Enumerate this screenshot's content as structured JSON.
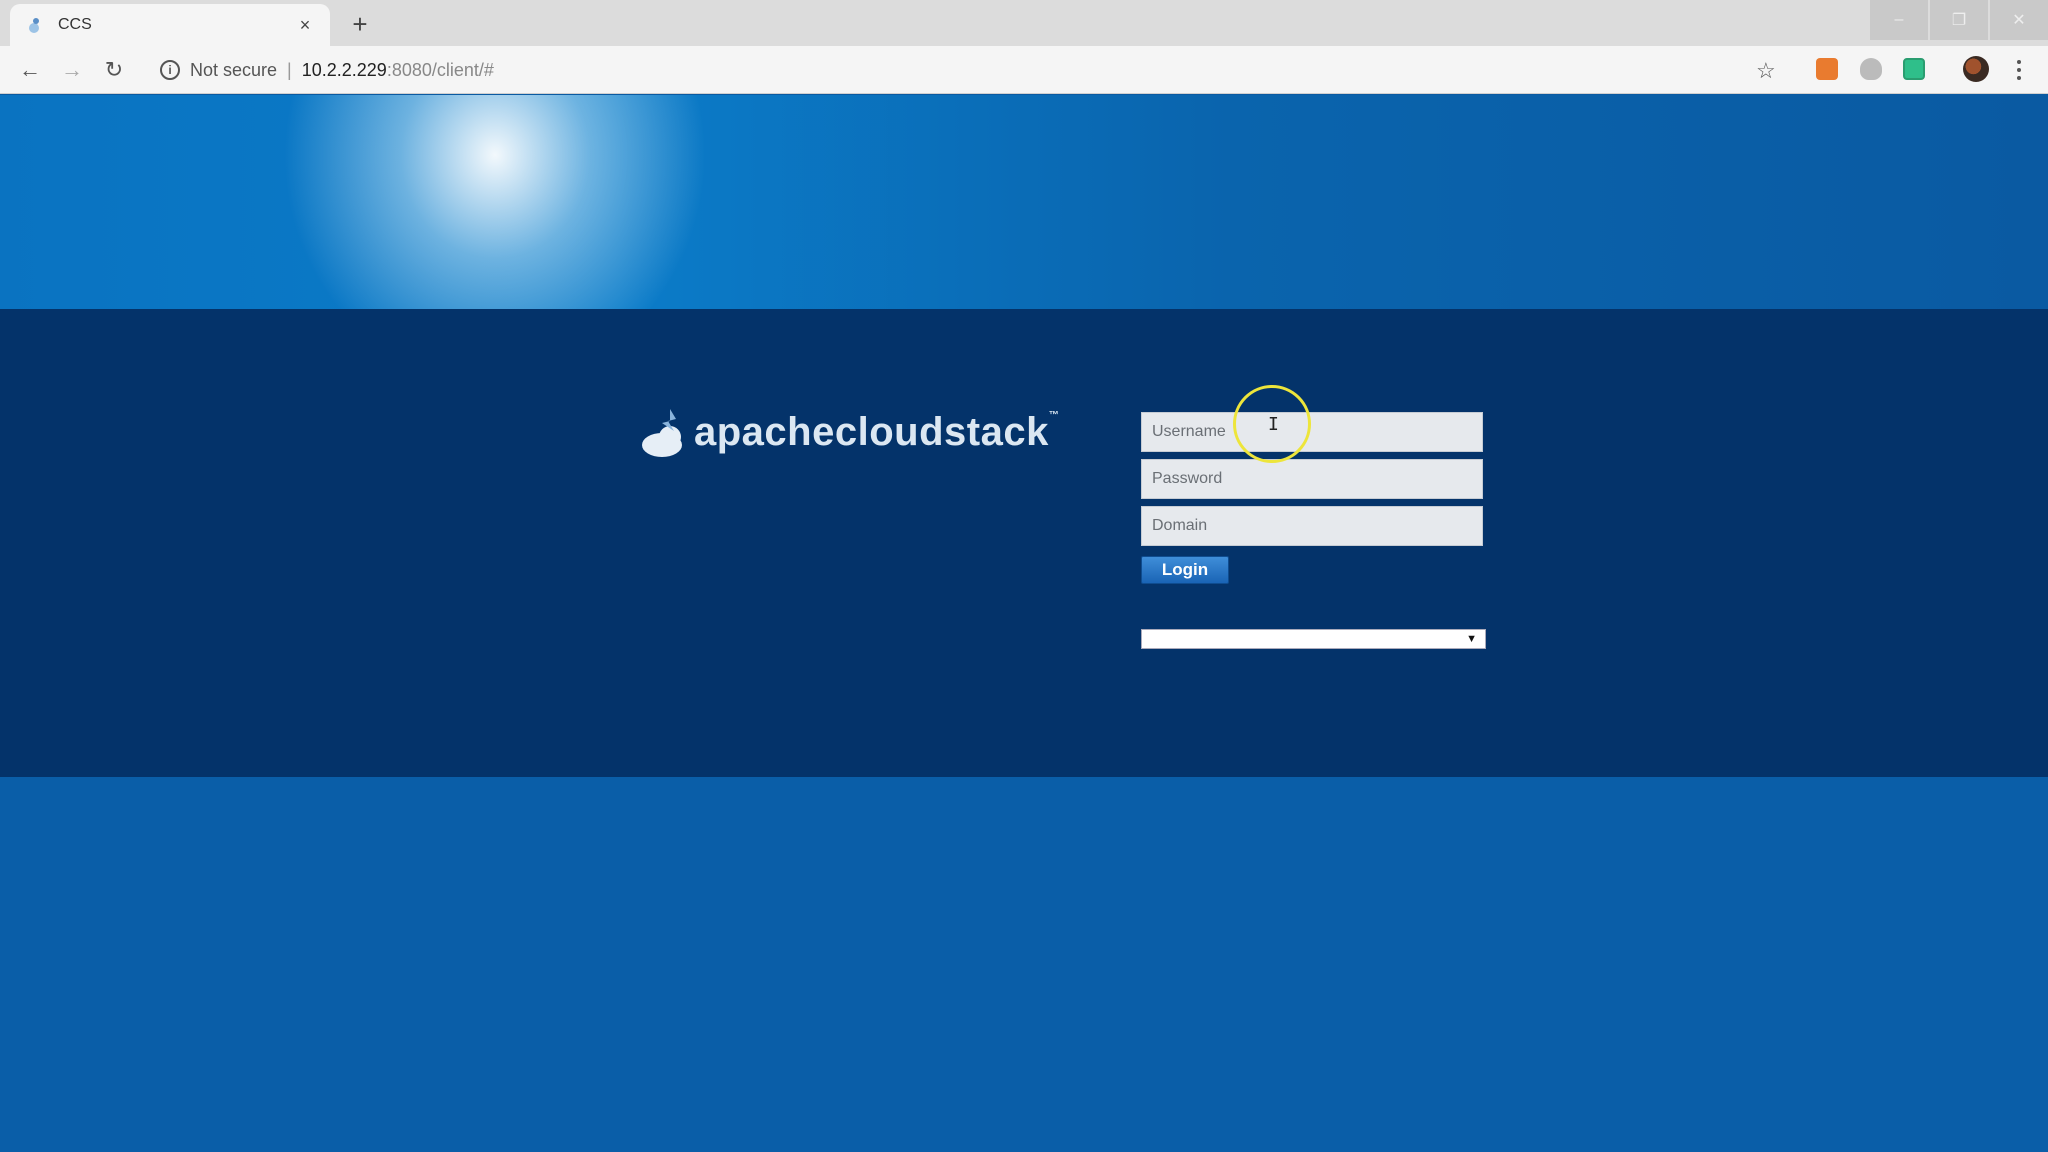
{
  "browser": {
    "tab": {
      "title": "CCS",
      "close_glyph": "×"
    },
    "new_tab_glyph": "+",
    "window_controls": {
      "minimize": "–",
      "restore": "❐",
      "close": "✕"
    },
    "nav": {
      "back": "←",
      "forward": "→",
      "reload": "↻"
    },
    "address_bar": {
      "security_label": "Not secure",
      "separator": "|",
      "host": "10.2.2.229",
      "path": ":8080/client/#"
    },
    "bookmark_glyph": "☆"
  },
  "page": {
    "logo": {
      "text": "apachecloudstack",
      "trademark": "™"
    },
    "login_form": {
      "username_placeholder": "Username",
      "password_placeholder": "Password",
      "domain_placeholder": "Domain",
      "login_label": "Login",
      "language_value": ""
    }
  },
  "colors": {
    "login_band": "#04336a",
    "page_blue": "#0a5ea8",
    "login_button": "#1a64b5",
    "cursor_highlight": "#ede53b"
  },
  "icons": {
    "tab_favicon": "cloudstack-icon",
    "address_info": "info-icon",
    "bookmark": "star-icon",
    "extension_1": "office-extension-icon",
    "extension_2": "shield-extension-icon",
    "extension_3": "green-extension-icon",
    "profile": "avatar-icon",
    "menu": "kebab-menu-icon",
    "cursor": "text-cursor-icon"
  }
}
